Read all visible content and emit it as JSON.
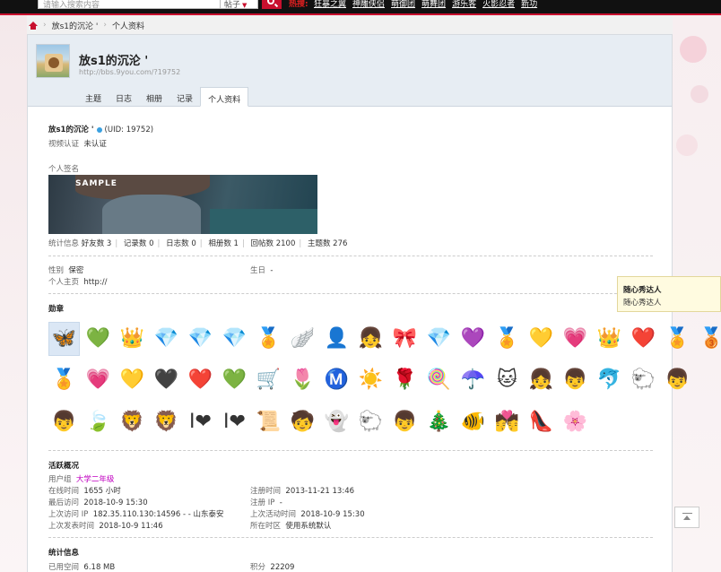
{
  "topbar": {
    "search_placeholder": "请输入搜索内容",
    "search_type": "帖子",
    "hot_label": "热搜:",
    "hot_links": [
      "狂暴之翼",
      "神雕侠侣",
      "萌御团",
      "萌舞团",
      "游乐客",
      "火影忍者",
      "新功"
    ]
  },
  "breadcrumb": {
    "items": [
      "放s1的沉沦 '",
      "个人资料"
    ]
  },
  "profile": {
    "name": "放s1的沉沦 '",
    "url": "http://bbs.9you.com/?19752",
    "tabs": [
      "主题",
      "日志",
      "相册",
      "记录",
      "个人资料"
    ]
  },
  "info": {
    "name": "放s1的沉沦 '",
    "uid": "(UID: 19752)",
    "video_cert_label": "视频认证",
    "video_cert_value": "未认证",
    "sig_label": "个人签名",
    "sig_sample": "SAMPLE",
    "stats_label": "统计信息",
    "stats": [
      "好友数 3",
      "记录数 0",
      "日志数 0",
      "相册数 1",
      "回帖数 2100",
      "主题数 276"
    ],
    "gender_label": "性别",
    "gender_value": "保密",
    "birthday_label": "生日",
    "birthday_value": "-",
    "homepage_label": "个人主页",
    "homepage_value": "http://"
  },
  "medals": {
    "title": "勋章",
    "rows": [
      [
        "🦋",
        "💚",
        "👑",
        "💎",
        "💎",
        "💎",
        "🏅",
        "🪽",
        "👤",
        "👧",
        "🎀",
        "💎",
        "💜",
        "🏅",
        "💛",
        "💗",
        "👑",
        "❤️",
        "🏅",
        "🥉"
      ],
      [
        "🏅",
        "💗",
        "💛",
        "🖤",
        "❤️",
        "💚",
        "🛒",
        "🌷",
        "Ⓜ️",
        "☀️",
        "🌹",
        "🍭",
        "☂️",
        "🐱",
        "👧",
        "👦",
        "🐬",
        "🐑",
        "👦"
      ],
      [
        "👦",
        "🍃",
        "🦁",
        "🦁",
        "I❤",
        "I❤",
        "📜",
        "🧒",
        "👻",
        "🐑",
        "👦",
        "🎄",
        "🐠",
        "💏",
        "👠",
        "🌸"
      ]
    ]
  },
  "tooltip": {
    "title": "随心秀达人",
    "desc": "随心秀达人"
  },
  "activity": {
    "title": "活跃概况",
    "group_label": "用户组",
    "group_value": "大学二年级",
    "online_label": "在线时间",
    "online_value": "1655 小时",
    "reg_label": "注册时间",
    "reg_value": "2013-11-21 13:46",
    "last_visit_label": "最后访问",
    "last_visit_value": "2018-10-9 15:30",
    "reg_ip_label": "注册 IP",
    "reg_ip_value": "-",
    "last_ip_label": "上次访问 IP",
    "last_ip_value": "182.35.110.130:14596 - - 山东泰安",
    "last_active_label": "上次活动时间",
    "last_active_value": "2018-10-9 15:30",
    "last_post_label": "上次发表时间",
    "last_post_value": "2018-10-9 11:46",
    "tz_label": "所在时区",
    "tz_value": "使用系统默认"
  },
  "statistics": {
    "title": "统计信息",
    "space_label": "已用空间",
    "space_value": "6.18 MB",
    "points_label": "积分",
    "points_value": "22209"
  }
}
